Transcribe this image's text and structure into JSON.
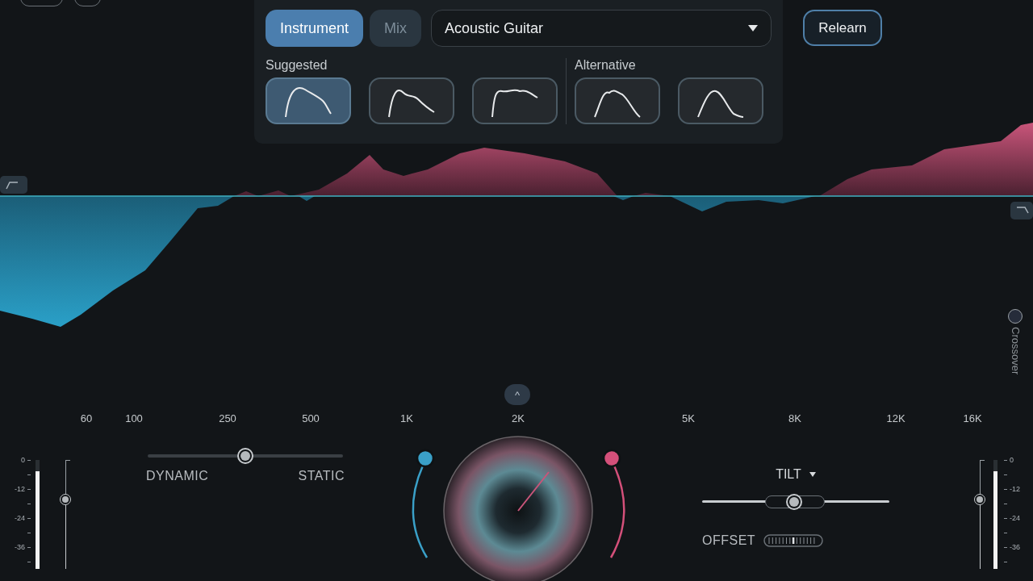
{
  "source_tabs": [
    {
      "label": "Instrument",
      "selected": true
    },
    {
      "label": "Mix",
      "selected": false
    }
  ],
  "instrument_dropdown": {
    "value": "Acoustic Guitar"
  },
  "relearn_button": "Relearn",
  "curve_groups": [
    {
      "label": "Suggested",
      "curves": [
        {
          "selected": true
        },
        {
          "selected": false
        },
        {
          "selected": false
        }
      ]
    },
    {
      "label": "Alternative",
      "curves": [
        {
          "selected": false
        },
        {
          "selected": false
        }
      ]
    }
  ],
  "crossover": {
    "label": "Crossover",
    "selected": false
  },
  "collapse_button": "^",
  "frequency_labels": [
    "60",
    "100",
    "250",
    "500",
    "1K",
    "2K",
    "5K",
    "8K",
    "12K",
    "16K"
  ],
  "input_meter": {
    "scale": [
      "0",
      "-12",
      "-24",
      "-36"
    ],
    "level": 0.9,
    "fader": {
      "level": 0.64
    }
  },
  "balance_slider": {
    "left_label": "DYNAMIC",
    "right_label": "STATIC",
    "level": 0.5
  },
  "tilt": {
    "label": "TILT",
    "level": 0.49,
    "offset_label": "OFFSET"
  },
  "output_meter": {
    "scale": [
      "0",
      "-12",
      "-24",
      "-36"
    ],
    "level": 0.9,
    "fader": {
      "level": 0.64
    }
  }
}
